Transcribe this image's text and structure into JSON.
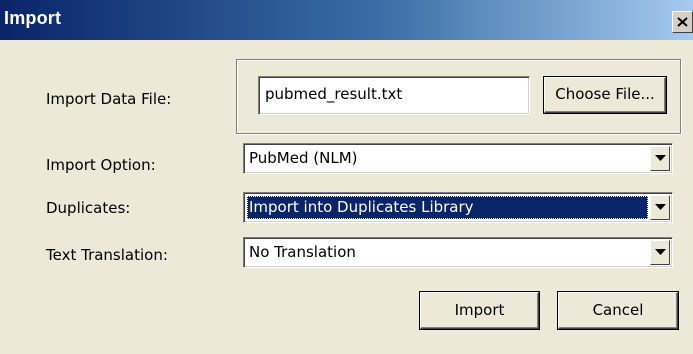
{
  "window": {
    "title": "Import",
    "close_glyph": "×"
  },
  "form": {
    "data_file": {
      "label": "Import Data File:",
      "value": "pubmed_result.txt",
      "choose_button": "Choose File..."
    },
    "import_option": {
      "label": "Import Option:",
      "selected": "PubMed (NLM)"
    },
    "duplicates": {
      "label": "Duplicates:",
      "selected": "Import into Duplicates Library"
    },
    "text_translation": {
      "label": "Text Translation:",
      "selected": "No Translation"
    }
  },
  "buttons": {
    "import": "Import",
    "cancel": "Cancel"
  },
  "colors": {
    "dialog_bg": "#ECE9D8",
    "titlebar_start": "#0A246A",
    "titlebar_end": "#A6CAF0",
    "selection": "#0A246A"
  },
  "icons": {
    "close": "close-icon",
    "dropdown": "chevron-down-icon"
  }
}
